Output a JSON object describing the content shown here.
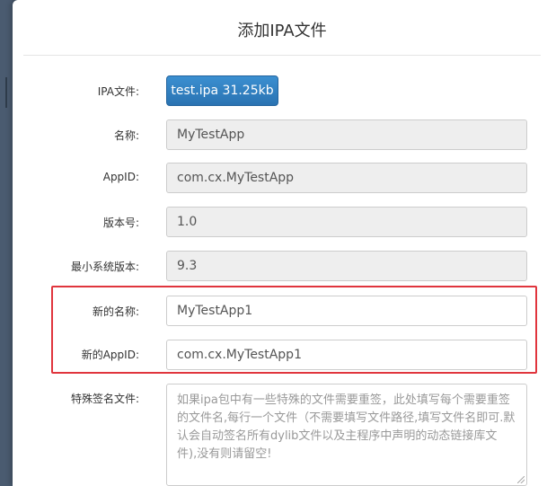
{
  "dialog": {
    "title": "添加IPA文件"
  },
  "form": {
    "ipa_file": {
      "label": "IPA文件:",
      "button_label": "test.ipa 31.25kb"
    },
    "name": {
      "label": "名称:",
      "value": "MyTestApp"
    },
    "app_id": {
      "label": "AppID:",
      "value": "com.cx.MyTestApp"
    },
    "version": {
      "label": "版本号:",
      "value": "1.0"
    },
    "min_os": {
      "label": "最小系统版本:",
      "value": "9.3"
    },
    "new_name": {
      "label": "新的名称:",
      "value": "MyTestApp1"
    },
    "new_app_id": {
      "label": "新的AppID:",
      "value": "com.cx.MyTestApp1"
    },
    "special_files": {
      "label": "特殊签名文件:",
      "placeholder": "如果ipa包中有一些特殊的文件需要重签，此处填写每个需要重签的文件名,每行一个文件（不需要填写文件路径,填写文件名即可.默认会自动签名所有dylib文件以及主程序中声明的动态链接库文件),没有则请留空!"
    }
  },
  "colors": {
    "primary_button": "#2a73b2",
    "highlight_border": "#e0353d",
    "readonly_bg": "#eeeeee"
  }
}
